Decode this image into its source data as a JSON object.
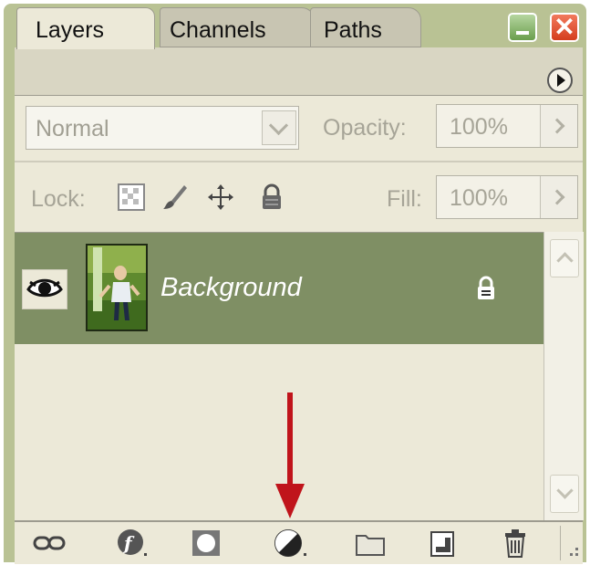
{
  "window": {
    "buttons": [
      "minimize",
      "close"
    ],
    "close_glyph": "✕"
  },
  "tabs": [
    {
      "label": "Layers",
      "active": true
    },
    {
      "label": "Channels",
      "active": false
    },
    {
      "label": "Paths",
      "active": false
    }
  ],
  "blend": {
    "mode": "Normal",
    "opacity_label": "Opacity:",
    "opacity_value": "100%"
  },
  "lock": {
    "label": "Lock:",
    "icons": [
      "lock-transparent-icon",
      "lock-image-icon",
      "lock-position-icon",
      "lock-all-icon"
    ],
    "fill_label": "Fill:",
    "fill_value": "100%"
  },
  "layers": [
    {
      "name": "Background",
      "visible": true,
      "locked": true
    }
  ],
  "toolbar": {
    "icons": [
      "link-layers-icon",
      "layer-style-icon",
      "layer-mask-icon",
      "adjustment-layer-icon",
      "new-group-icon",
      "new-layer-icon",
      "trash-icon"
    ]
  },
  "colors": {
    "frame": "#b9c294",
    "panel": "#ece9d8",
    "selected_layer": "#7f8f64",
    "annotation_arrow": "#c0141b"
  }
}
